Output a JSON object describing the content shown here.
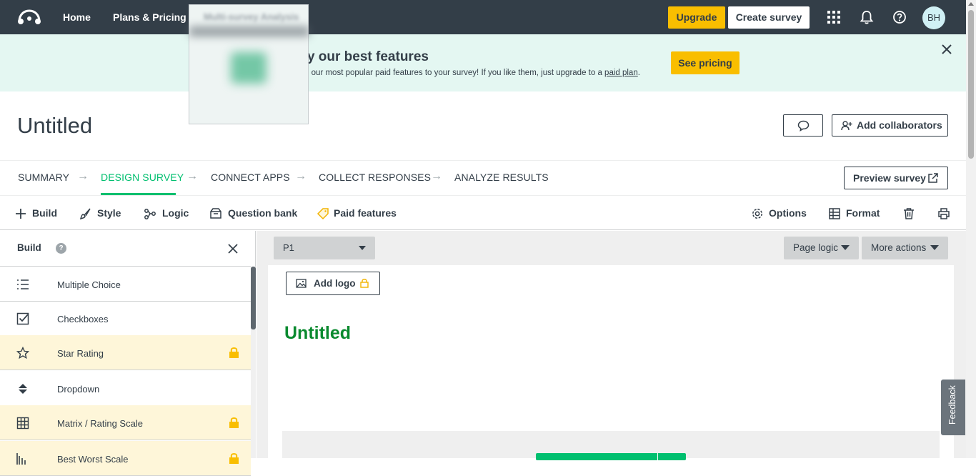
{
  "topnav": {
    "home": "Home",
    "plans": "Plans & Pricing",
    "upgrade": "Upgrade",
    "create_survey": "Create survey",
    "avatar_initials": "BH",
    "hover_item": "Multi-survey Analysis"
  },
  "banner": {
    "title": "Try our best features",
    "text_prefix": "Add our most popular paid features to your survey! If you like them, just upgrade to a ",
    "text_link": "paid plan",
    "text_suffix": ".",
    "button": "See pricing"
  },
  "survey": {
    "title": "Untitled",
    "add_collaborators": "Add collaborators",
    "preview": "Preview survey"
  },
  "steps": [
    {
      "label": "SUMMARY",
      "active": false
    },
    {
      "label": "DESIGN SURVEY",
      "active": true
    },
    {
      "label": "CONNECT APPS",
      "active": false
    },
    {
      "label": "COLLECT RESPONSES",
      "active": false
    },
    {
      "label": "ANALYZE RESULTS",
      "active": false
    }
  ],
  "toolbar": {
    "build": "Build",
    "style": "Style",
    "logic": "Logic",
    "question_bank": "Question bank",
    "paid_features": "Paid features",
    "options": "Options",
    "format": "Format"
  },
  "build_panel": {
    "title": "Build",
    "help": "?",
    "items": [
      {
        "label": "Multiple Choice",
        "icon": "list-icon",
        "locked": false
      },
      {
        "label": "Checkboxes",
        "icon": "checkbox-icon",
        "locked": false
      },
      {
        "label": "Star Rating",
        "icon": "star-icon",
        "locked": true
      },
      {
        "label": "Dropdown",
        "icon": "dropdown-icon",
        "locked": false
      },
      {
        "label": "Matrix / Rating Scale",
        "icon": "grid-icon",
        "locked": true
      },
      {
        "label": "Best Worst Scale",
        "icon": "bars-icon",
        "locked": true
      }
    ]
  },
  "canvas": {
    "page_select": "P1",
    "page_logic": "Page logic",
    "more_actions": "More actions",
    "add_logo": "Add logo",
    "survey_title": "Untitled"
  },
  "feedback": "Feedback",
  "colors": {
    "nav_bg": "#333e48",
    "accent_green": "#00bf6f",
    "upgrade_yellow": "#f9be00",
    "banner_bg": "#e4f7f2",
    "locked_bg": "#fef6d9",
    "survey_title_green": "#0a8a2f"
  }
}
